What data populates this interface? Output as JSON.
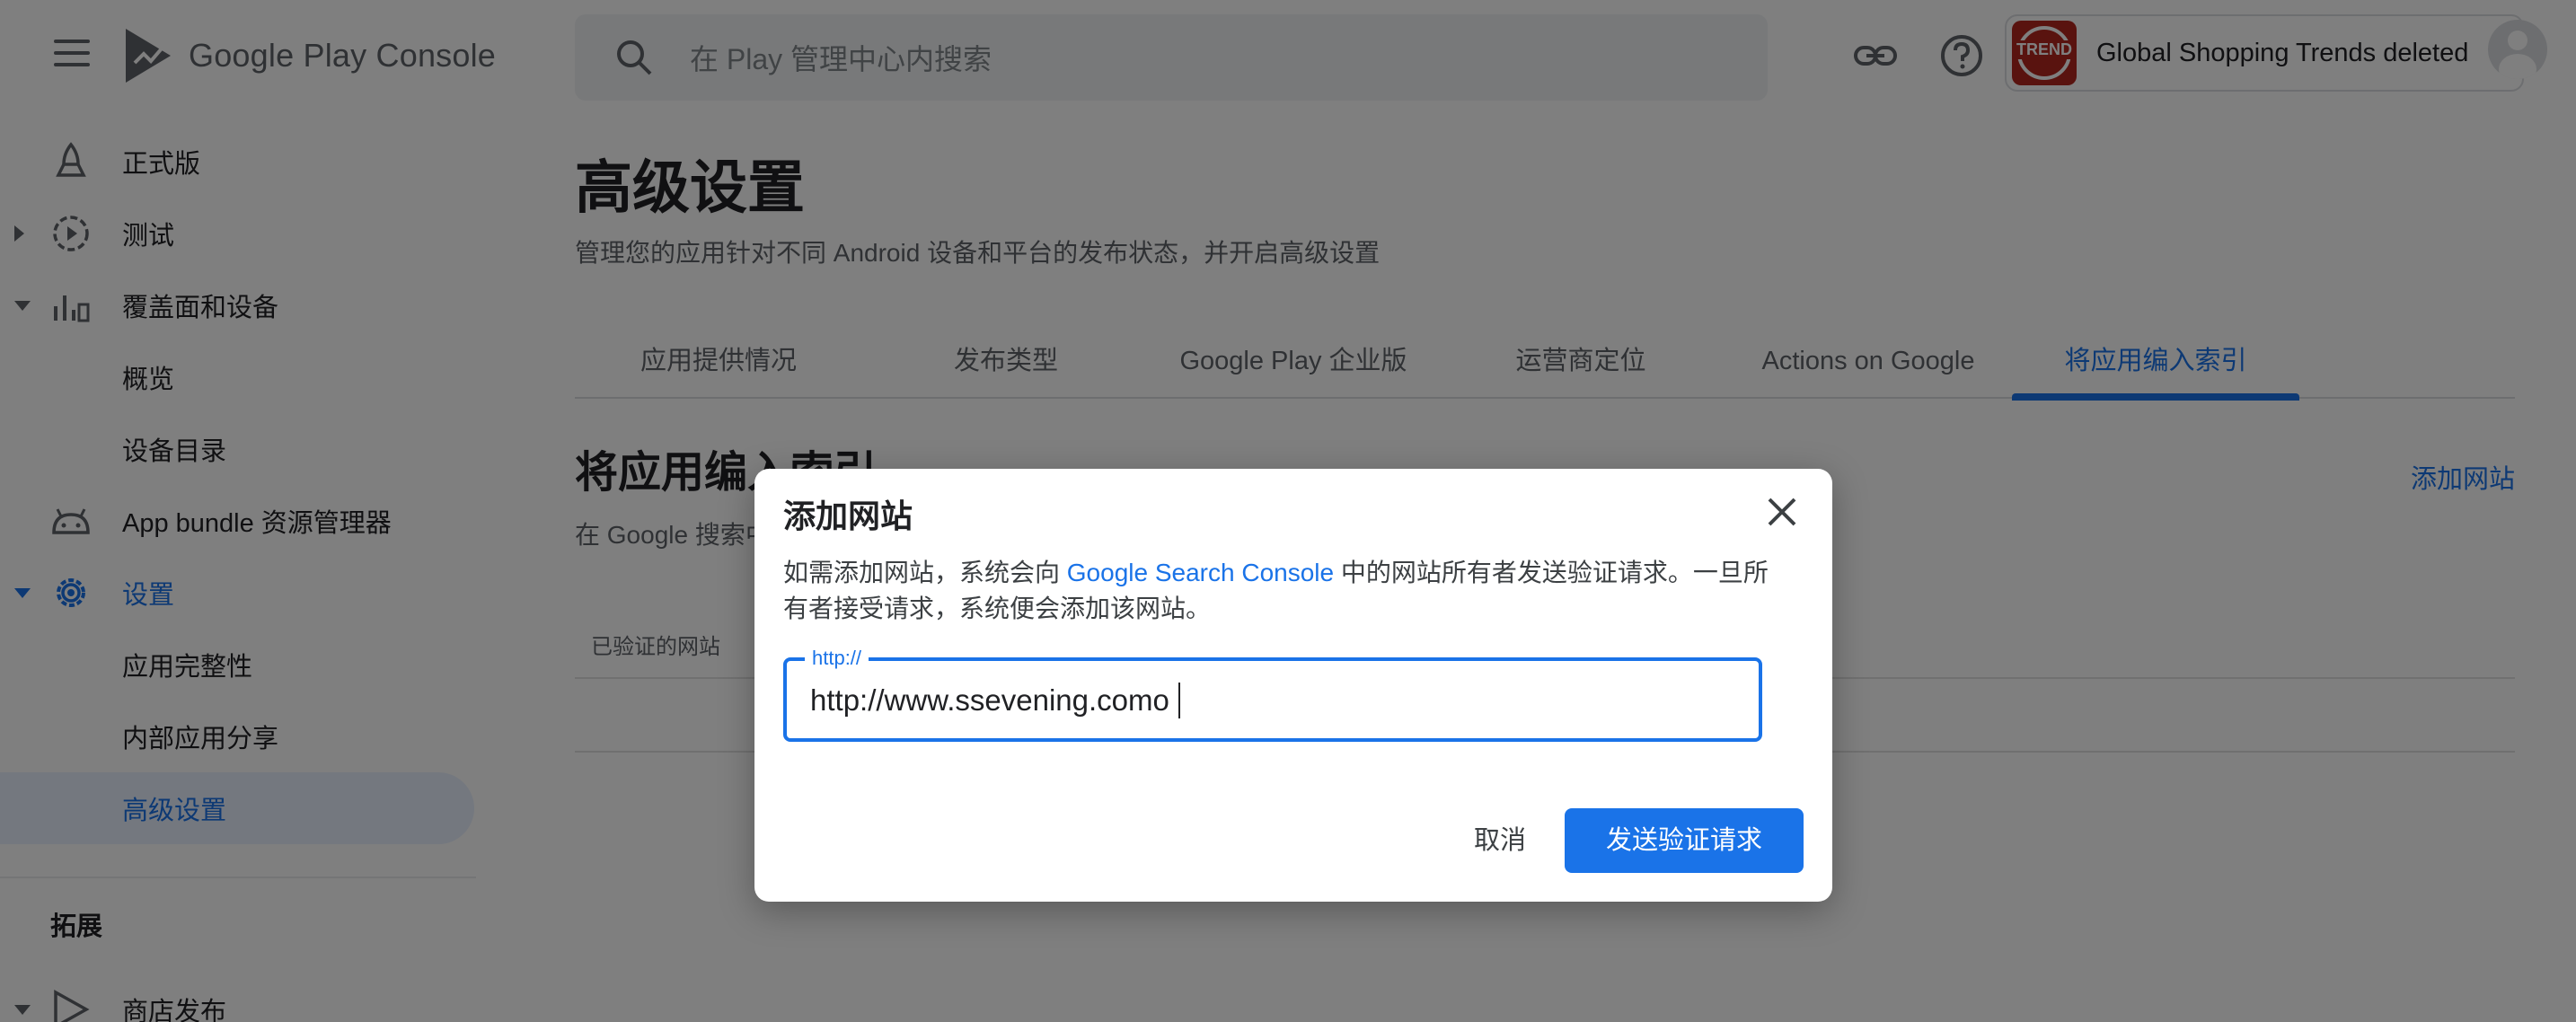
{
  "header": {
    "brand": "Google Play Console",
    "search_placeholder": "在 Play 管理中心内搜索",
    "app_name": "Global Shopping Trends deleted",
    "app_logo_text": "TREND"
  },
  "sidebar": {
    "items": [
      {
        "label": "正式版",
        "icon": "rocket-icon"
      },
      {
        "label": "测试",
        "icon": "play-circle-icon"
      },
      {
        "label": "覆盖面和设备",
        "icon": "bar-chart-icon"
      },
      {
        "label": "概览"
      },
      {
        "label": "设备目录"
      },
      {
        "label": "App bundle 资源管理器",
        "icon": "android-icon"
      },
      {
        "label": "设置",
        "icon": "gear-icon"
      },
      {
        "label": "应用完整性"
      },
      {
        "label": "内部应用分享"
      },
      {
        "label": "高级设置"
      },
      {
        "label": "商店发布",
        "icon": "store-icon"
      }
    ],
    "section_heading": "拓展"
  },
  "main": {
    "title": "高级设置",
    "subtitle": "管理您的应用针对不同 Android 设备和平台的发布状态，并开启高级设置",
    "tabs": [
      {
        "label": "应用提供情况"
      },
      {
        "label": "发布类型"
      },
      {
        "label": "Google Play 企业版"
      },
      {
        "label": "运营商定位"
      },
      {
        "label": "Actions on Google"
      },
      {
        "label": "将应用编入索引"
      }
    ],
    "section_title": "将应用编入索引",
    "section_desc": "在 Google 搜索中",
    "add_site_link": "添加网站",
    "table_header": "已验证的网站"
  },
  "dialog": {
    "title": "添加网站",
    "body_prefix": "如需添加网站，系统会向 ",
    "body_link": "Google Search Console",
    "body_suffix": " 中的网站所有者发送验证请求。一旦所有者接受请求，系统便会添加该网站。",
    "field_label": "http://",
    "field_value": "http://www.ssevening.como",
    "cancel_label": "取消",
    "submit_label": "发送验证请求"
  },
  "colors": {
    "accent": "#1a73e8",
    "app_logo": "#b3261e",
    "scrim": "rgba(0,0,0,0.5)"
  }
}
